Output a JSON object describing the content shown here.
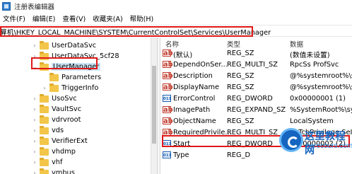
{
  "window": {
    "title": "注册表编辑器"
  },
  "menu": [
    "文件(F)",
    "编辑(E)",
    "查看(V)",
    "收藏夹(A)",
    "帮助(H)"
  ],
  "address": "算机\\HKEY_LOCAL_MACHINE\\SYSTEM\\CurrentControlSet\\Services\\UserManager",
  "tree": [
    {
      "label": "UserDataSvc",
      "expander": "›",
      "indent": 0
    },
    {
      "label": "UserDataSvc_5cf28",
      "expander": "›",
      "indent": 0
    },
    {
      "label": "UserManager",
      "expander": "⌄",
      "indent": 0,
      "selected": true
    },
    {
      "label": "Parameters",
      "expander": "",
      "indent": 1
    },
    {
      "label": "TriggerInfo",
      "expander": "›",
      "indent": 1
    },
    {
      "label": "UsoSvc",
      "expander": "›",
      "indent": 0
    },
    {
      "label": "VaultSvc",
      "expander": "›",
      "indent": 0
    },
    {
      "label": "vdrvroot",
      "expander": "›",
      "indent": 0
    },
    {
      "label": "vds",
      "expander": "›",
      "indent": 0
    },
    {
      "label": "VerifierExt",
      "expander": "›",
      "indent": 0
    },
    {
      "label": "vhdmp",
      "expander": "›",
      "indent": 0
    },
    {
      "label": "vhf",
      "expander": "›",
      "indent": 0
    },
    {
      "label": "vmbus",
      "expander": "›",
      "indent": 0
    }
  ],
  "columns": {
    "name": "名称",
    "type": "类型",
    "data": "数据"
  },
  "values": [
    {
      "icon": "ab",
      "name": "(默认)",
      "type": "REG_SZ",
      "data": "(数值未设置)"
    },
    {
      "icon": "ab",
      "name": "DependOnSer...",
      "type": "REG_MULTI_SZ",
      "data": "RpcSs ProfSvc"
    },
    {
      "icon": "ab",
      "name": "Description",
      "type": "REG_SZ",
      "data": "@%systemroot%\\sy"
    },
    {
      "icon": "ab",
      "name": "DisplayName",
      "type": "REG_SZ",
      "data": "@%systemroot%\\sy"
    },
    {
      "icon": "011",
      "name": "ErrorControl",
      "type": "REG_DWORD",
      "data": "0x00000001 (1)"
    },
    {
      "icon": "ab",
      "name": "ImagePath",
      "type": "REG_EXPAND_SZ",
      "data": "%SystemRoot%\\sys"
    },
    {
      "icon": "ab",
      "name": "ObjectName",
      "type": "REG_SZ",
      "data": "LocalSystem"
    },
    {
      "icon": "ab",
      "name": "RequiredPrivile...",
      "type": "REG_MULTI_SZ",
      "data": "SeTcbPrivilege SeIm"
    },
    {
      "icon": "011",
      "name": "Start",
      "type": "REG_DWORD",
      "data": "0x00000002 (2)"
    },
    {
      "icon": "011",
      "name": "Type",
      "type": "REG_D",
      "data": ""
    }
  ],
  "watermark": {
    "title": "这里教程网",
    "sub": "herecours.com"
  }
}
